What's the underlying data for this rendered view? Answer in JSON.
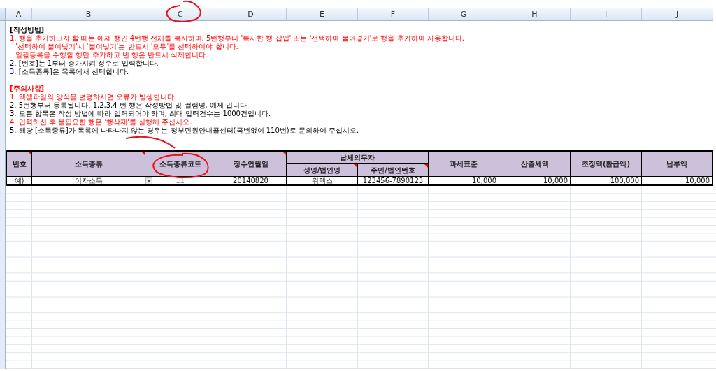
{
  "columns": [
    "A",
    "B",
    "C",
    "D",
    "E",
    "F",
    "G",
    "H",
    "I",
    "J"
  ],
  "instructions": [
    {
      "text": "[작성방법]",
      "emphasis": false,
      "bold": true
    },
    {
      "number": "1.",
      "text": "행을 추가하고자 할 때는 예제 행인 4번행 전체를 복사하여, 5번행부터 '복사한 행 삽입' 또는 '선택하여 붙여넣기'로 행을 추가하여 사용합니다.",
      "emphasis": true,
      "bold": false
    },
    {
      "text": "'선택하여 붙여넣기'시 '붙여넣기'는 반드시 '모두'를 선택하여야 합니다.",
      "emphasis": true,
      "bold": false
    },
    {
      "text": "일괄등록을 수행할 행만 추가하고 빈 행은 반드시 삭제합니다.",
      "emphasis": true,
      "bold": false
    },
    {
      "number": "2.",
      "text": "[번호]는 1부터 증가시켜 정수로 입력합니다.",
      "emphasis": false,
      "bold": false
    },
    {
      "number": "3.",
      "number_highlighted": true,
      "text": "[소득종류]은 목록에서 선택합니다.",
      "emphasis": false,
      "bold": false
    },
    {
      "text": "[주의사항]",
      "emphasis": true,
      "bold": true
    },
    {
      "number": "1.",
      "text": "엑셀파일의 양식을 변경하시면 오류가 발생합니다.",
      "emphasis": true,
      "bold": false
    },
    {
      "number": "2.",
      "text": "5번행부터 등록됩니다. 1,2,3,4 번 행은 작성방법 및 컬럼명, 예제 입니다.",
      "emphasis": false,
      "bold": false
    },
    {
      "number": "3.",
      "text": "모든 항목은 작성 방법에 따라 입력되어야 하며, 최대 입력건수는 1000건입니다.",
      "emphasis": false,
      "bold": false
    },
    {
      "number": "4.",
      "text": "입력하신 후 불필요한 행은 '행삭제'를 실행해 주십시오.",
      "emphasis": true,
      "bold": false
    },
    {
      "number": "5.",
      "text": "해당 [소득종류]가 목록에 나타나지 않는 경우는 정부민원안내콜센터(국번없이 110번)로 문의하여 주십시오.",
      "emphasis": false,
      "bold": false
    }
  ],
  "table": {
    "headers": [
      {
        "label": "번호",
        "comment": true
      },
      {
        "label": "소득종류",
        "comment": true
      },
      {
        "label": "소득종류코드",
        "comment": false
      },
      {
        "label": "징수연월일",
        "comment": true
      },
      {
        "label": "납세의무자",
        "comment": false,
        "kind": "group"
      },
      {
        "label": "과세표준",
        "comment": false
      },
      {
        "label": "산출세액",
        "comment": false
      },
      {
        "label": "조정액(환급액)",
        "comment": false
      },
      {
        "label": "납부액",
        "comment": false
      }
    ],
    "subheaders": [
      {
        "label": "성명/법인명",
        "comment": true
      },
      {
        "label": "주민/법인번호",
        "comment": true
      }
    ],
    "example_row": [
      {
        "text": "예)"
      },
      {
        "text": "이자소득",
        "dropdown": true
      },
      {
        "text": "11",
        "disabled": true
      },
      {
        "text": "20140820"
      },
      {
        "text": "위택스"
      },
      {
        "text": "123456-7890123"
      },
      {
        "text": "10,000"
      },
      {
        "text": "10,000"
      },
      {
        "text": "100,000"
      },
      {
        "text": "10,000"
      }
    ]
  }
}
